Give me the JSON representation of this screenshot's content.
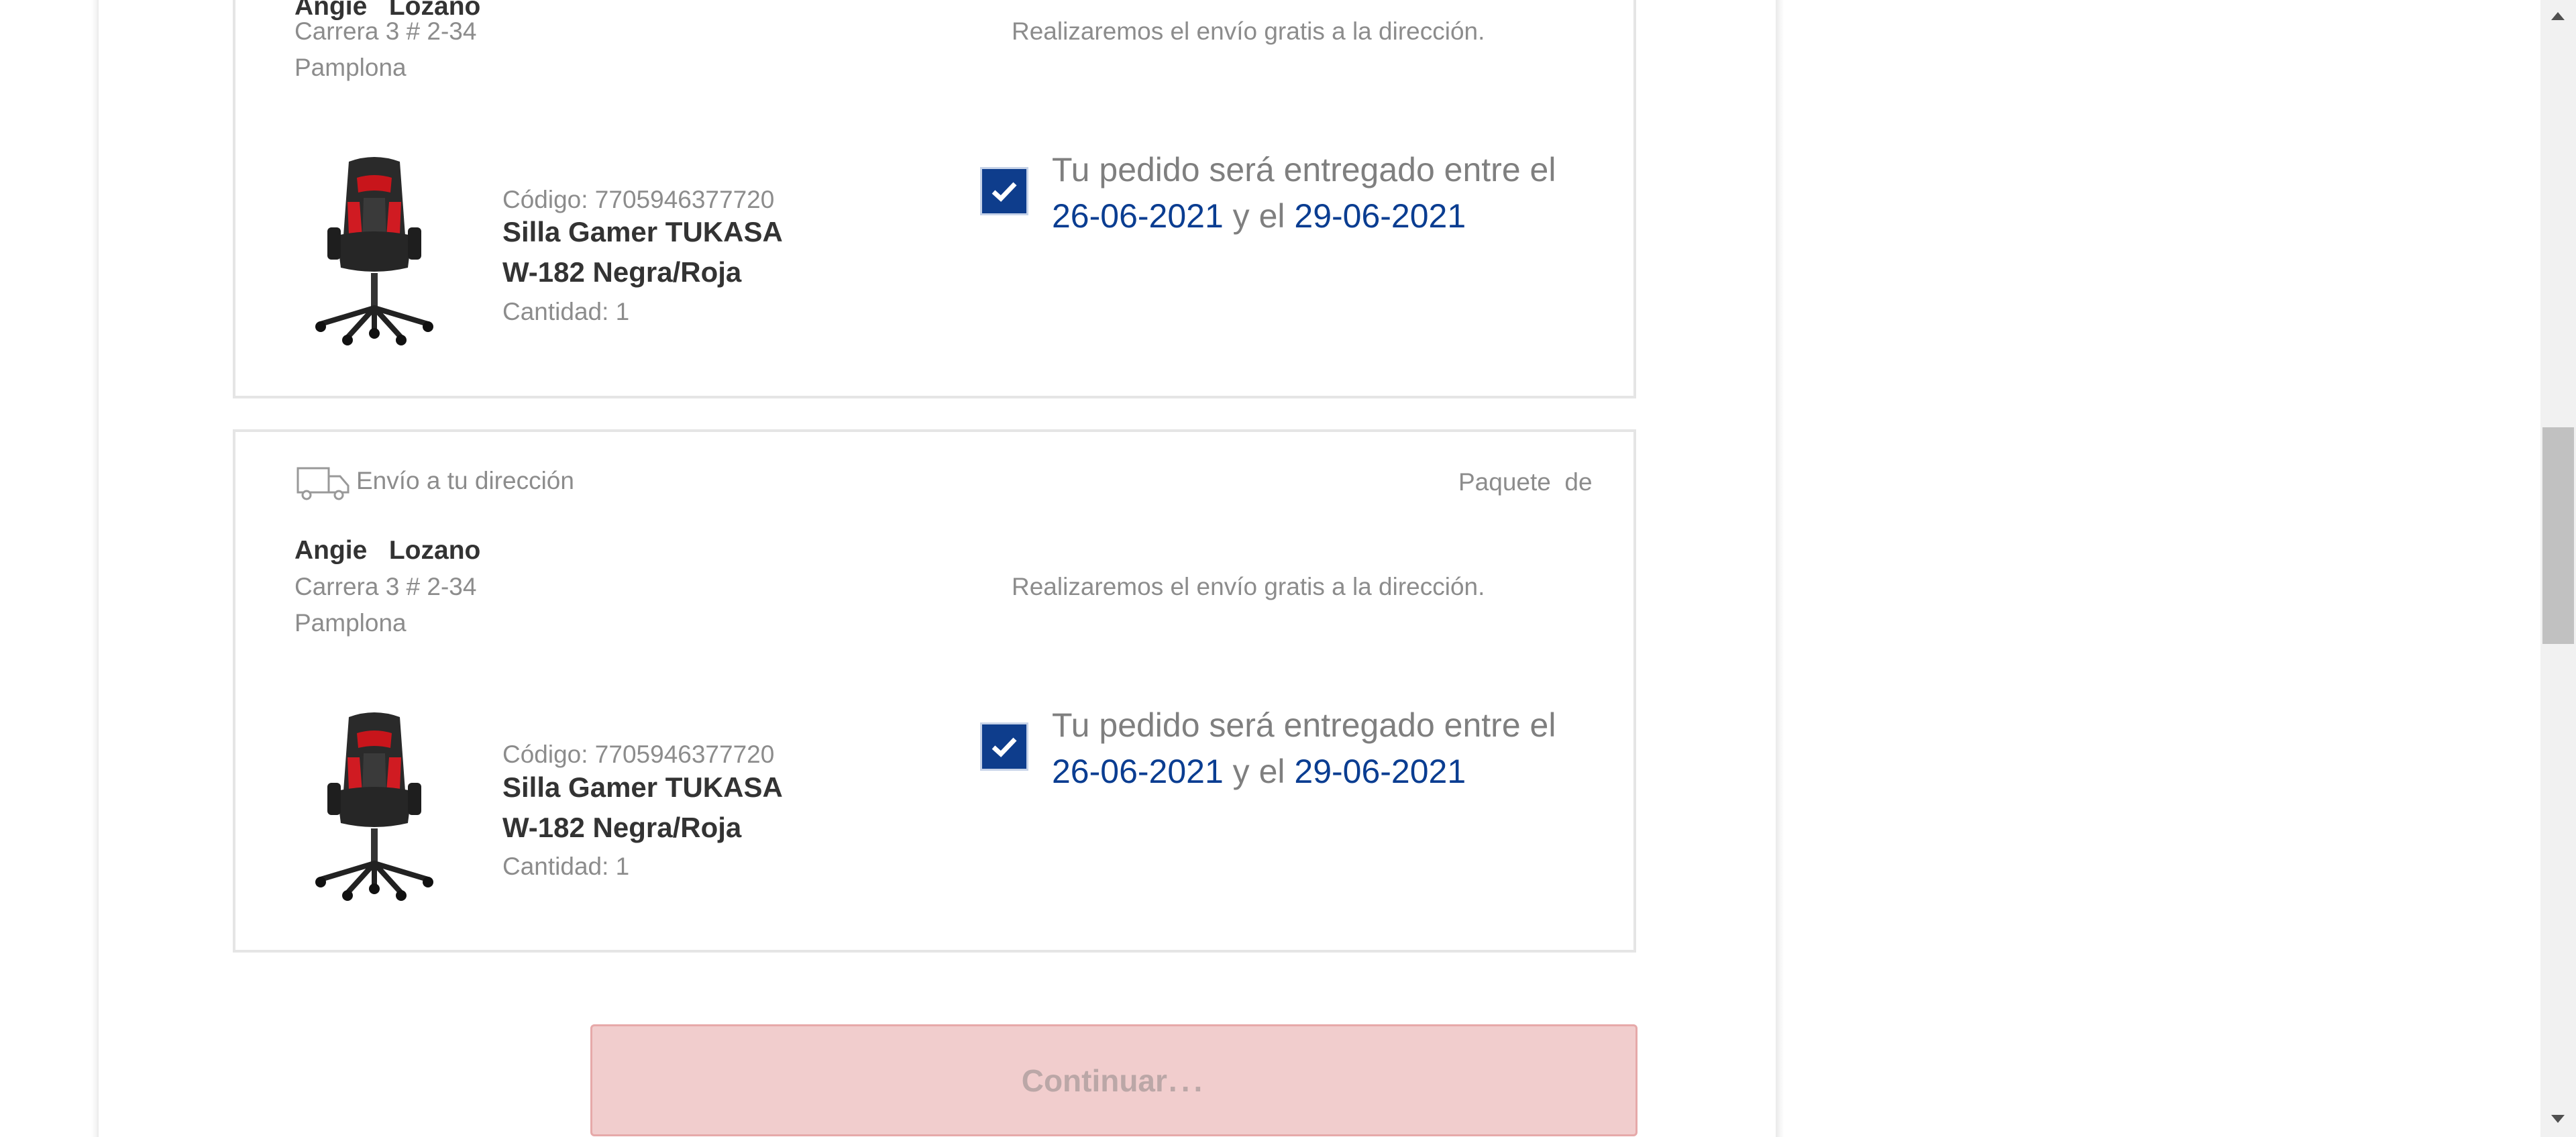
{
  "package1": {
    "name_first": "Angie",
    "name_last": "Lozano",
    "address": "Carrera 3 # 2-34",
    "city": "Pamplona",
    "free_shipping_note": "Realizaremos el envío gratis a la dirección.",
    "product": {
      "code": "Código: 7705946377720",
      "name_line1": "Silla Gamer TUKASA",
      "name_line2": "W-182 Negra/Roja",
      "quantity": "Cantidad: 1",
      "image_icon": "gaming-chair-image"
    },
    "delivery": {
      "prefix": "Tu pedido será entregado entre el",
      "date_from": "26-06-2021",
      "conjunction": "y el",
      "date_to": "29-06-2021",
      "checked": true
    }
  },
  "package2": {
    "shipping_type": "Envío a tu dirección",
    "shipping_icon": "truck-icon",
    "package_label": "Paquete",
    "package_of": "de",
    "name_first": "Angie",
    "name_last": "Lozano",
    "address": "Carrera 3 # 2-34",
    "city": "Pamplona",
    "free_shipping_note": "Realizaremos el envío gratis a la dirección.",
    "product": {
      "code": "Código: 7705946377720",
      "name_line1": "Silla Gamer TUKASA",
      "name_line2": "W-182 Negra/Roja",
      "quantity": "Cantidad: 1",
      "image_icon": "gaming-chair-image"
    },
    "delivery": {
      "prefix": "Tu pedido será entregado entre el",
      "date_from": "26-06-2021",
      "conjunction": "y el",
      "date_to": "29-06-2021",
      "checked": true
    }
  },
  "continue_button": {
    "label": "Continuar",
    "dots": "..."
  },
  "colors": {
    "accent_blue": "#0e3d8c",
    "button_bg": "#f1cdcd"
  }
}
